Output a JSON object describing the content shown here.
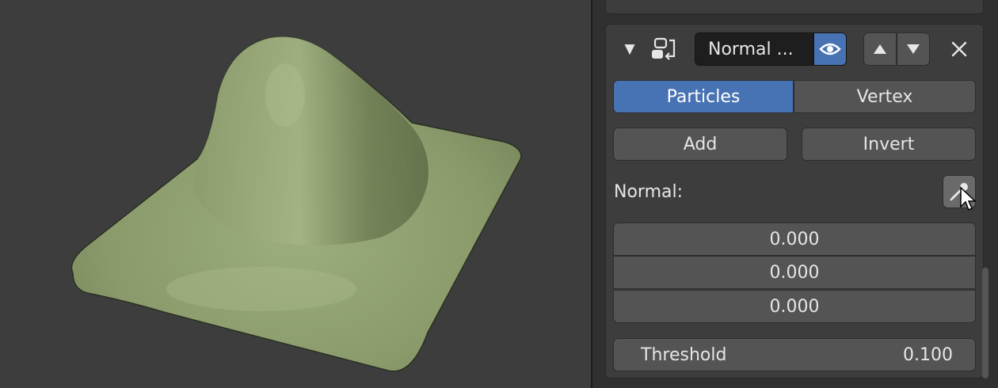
{
  "viewport": {
    "object_color": "#8f9f6f",
    "background": "#3d3d3d"
  },
  "modifier": {
    "collapse_icon": "triangle-down-icon",
    "type_icon": "normal-edit-modifier-icon",
    "name": "Normal ...",
    "visibility_icon": "eye-icon",
    "move_up_icon": "triangle-up-icon",
    "move_down_icon": "triangle-down-icon",
    "remove_icon": "close-icon",
    "mode_tabs": [
      {
        "label": "Particles",
        "active": true
      },
      {
        "label": "Vertex",
        "active": false
      }
    ],
    "add_label": "Add",
    "invert_label": "Invert",
    "normal_label": "Normal:",
    "picker_icon": "eyedropper-icon",
    "normal_values": [
      "0.000",
      "0.000",
      "0.000"
    ],
    "threshold_label": "Threshold",
    "threshold_value": "0.100"
  },
  "colors": {
    "accent": "#4772b3",
    "panel": "#3d3d3d",
    "button": "#545454"
  }
}
